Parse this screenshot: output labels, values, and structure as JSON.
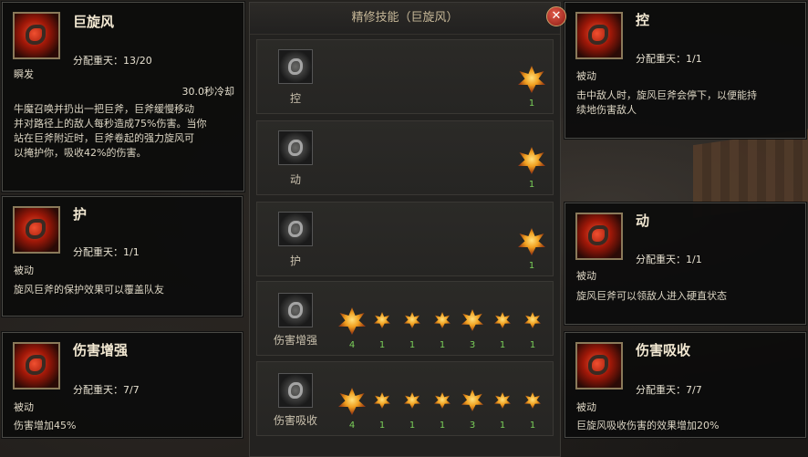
{
  "panel": {
    "title": "精修技能（巨旋风）",
    "close": "✕"
  },
  "rows": [
    {
      "label": "控",
      "stars": [
        {
          "count": "1"
        }
      ]
    },
    {
      "label": "动",
      "stars": [
        {
          "count": "1"
        }
      ]
    },
    {
      "label": "护",
      "stars": [
        {
          "count": "1"
        }
      ]
    },
    {
      "label": "伤害增强",
      "stars": [
        {
          "count": "4"
        },
        {
          "count": "1"
        },
        {
          "count": "1"
        },
        {
          "count": "1"
        },
        {
          "count": "3"
        },
        {
          "count": "1"
        },
        {
          "count": "1"
        }
      ]
    },
    {
      "label": "伤害吸收",
      "stars": [
        {
          "count": "4"
        },
        {
          "count": "1"
        },
        {
          "count": "1"
        },
        {
          "count": "1"
        },
        {
          "count": "3"
        },
        {
          "count": "1"
        },
        {
          "count": "1"
        }
      ]
    }
  ],
  "tooltips": {
    "main": {
      "name": "巨旋风",
      "alloc": "分配重天：13/20",
      "type": "瞬发",
      "cooldown": "30.0秒冷却",
      "desc": [
        "牛魔召唤并扔出一把巨斧，巨斧缓慢移动",
        "并对路径上的敌人每秒造成75%伤害。当你",
        "站在巨斧附近时，巨斧卷起的强力旋风可",
        "以掩护你，吸收42%的伤害。"
      ]
    },
    "hu": {
      "name": "护",
      "alloc": "分配重天：1/1",
      "type": "被动",
      "desc": [
        "旋风巨斧的保护效果可以覆盖队友"
      ]
    },
    "shzq": {
      "name": "伤害增强",
      "alloc": "分配重天：7/7",
      "type": "被动",
      "desc": [
        "伤害增加45%"
      ]
    },
    "kong": {
      "name": "控",
      "alloc": "分配重天：1/1",
      "type": "被动",
      "desc": [
        "击中敌人时，旋风巨斧会停下，以便能持",
        "续地伤害敌人"
      ]
    },
    "dong": {
      "name": "动",
      "alloc": "分配重天：1/1",
      "type": "被动",
      "desc": [
        "旋风巨斧可以领敌人进入硬直状态"
      ]
    },
    "shxs": {
      "name": "伤害吸收",
      "alloc": "分配重天：7/7",
      "type": "被动",
      "desc": [
        "巨旋风吸收伤害的效果增加20%"
      ]
    }
  }
}
